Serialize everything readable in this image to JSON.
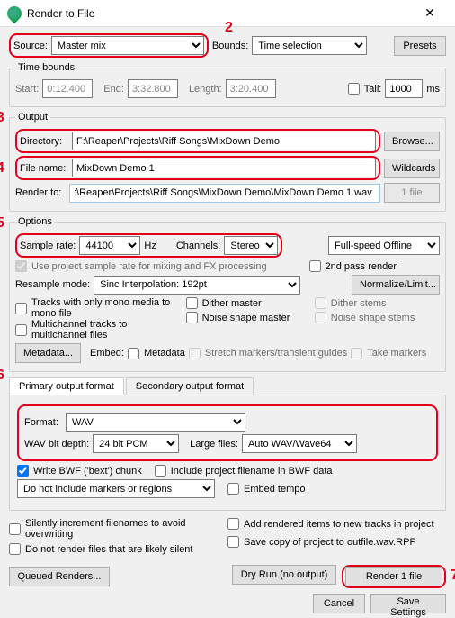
{
  "window": {
    "title": "Render to File"
  },
  "annotations": {
    "n2": "2",
    "n3": "3",
    "n4": "4",
    "n5": "5",
    "n6": "6",
    "n7": "7"
  },
  "top": {
    "source_label": "Source:",
    "source_value": "Master mix",
    "bounds_label": "Bounds:",
    "bounds_value": "Time selection",
    "presets_btn": "Presets"
  },
  "timebounds": {
    "legend": "Time bounds",
    "start_label": "Start:",
    "start_value": "0:12.400",
    "end_label": "End:",
    "end_value": "3:32.800",
    "length_label": "Length:",
    "length_value": "3:20.400",
    "tail_label": "Tail:",
    "tail_value": "1000",
    "tail_unit": "ms"
  },
  "output": {
    "legend": "Output",
    "dir_label": "Directory:",
    "dir_value": "F:\\Reaper\\Projects\\Riff Songs\\MixDown Demo",
    "browse_btn": "Browse...",
    "file_label": "File name:",
    "file_value": "MixDown Demo 1",
    "wildcards_btn": "Wildcards",
    "renderto_label": "Render to:",
    "renderto_value": ":\\Reaper\\Projects\\Riff Songs\\MixDown Demo\\MixDown Demo 1.wav",
    "onefile_btn": "1 file"
  },
  "options": {
    "legend": "Options",
    "sr_label": "Sample rate:",
    "sr_value": "44100",
    "hz": "Hz",
    "ch_label": "Channels:",
    "ch_value": "Stereo",
    "speed_value": "Full-speed Offline",
    "use_proj_sr": "Use project sample rate for mixing and FX processing",
    "second_pass": "2nd pass render",
    "resample_label": "Resample mode:",
    "resample_value": "Sinc Interpolation: 192pt",
    "normalize_btn": "Normalize/Limit...",
    "mono_tracks": "Tracks with only mono media to mono file",
    "multichan": "Multichannel tracks to multichannel files",
    "dither_master": "Dither master",
    "noise_master": "Noise shape master",
    "dither_stems": "Dither stems",
    "noise_stems": "Noise shape stems",
    "metadata_btn": "Metadata...",
    "embed_label": "Embed:",
    "embed_metadata": "Metadata",
    "embed_stretch": "Stretch markers/transient guides",
    "embed_take": "Take markers"
  },
  "tabs": {
    "primary": "Primary output format",
    "secondary": "Secondary output format"
  },
  "format": {
    "format_label": "Format:",
    "format_value": "WAV",
    "bitdepth_label": "WAV bit depth:",
    "bitdepth_value": "24 bit PCM",
    "large_label": "Large files:",
    "large_value": "Auto WAV/Wave64",
    "write_bwf": "Write BWF ('bext') chunk",
    "incl_proj": "Include project filename in BWF data",
    "markers_value": "Do not include markers or regions",
    "embed_tempo": "Embed tempo"
  },
  "bottom": {
    "silent_incr": "Silently increment filenames to avoid overwriting",
    "no_silent": "Do not render files that are likely silent",
    "add_tracks": "Add rendered items to new tracks in project",
    "save_copy": "Save copy of project to outfile.wav.RPP",
    "queued_btn": "Queued Renders...",
    "dryrun_btn": "Dry Run (no output)",
    "render_btn": "Render 1 file",
    "cancel_btn": "Cancel",
    "save_btn": "Save Settings"
  }
}
